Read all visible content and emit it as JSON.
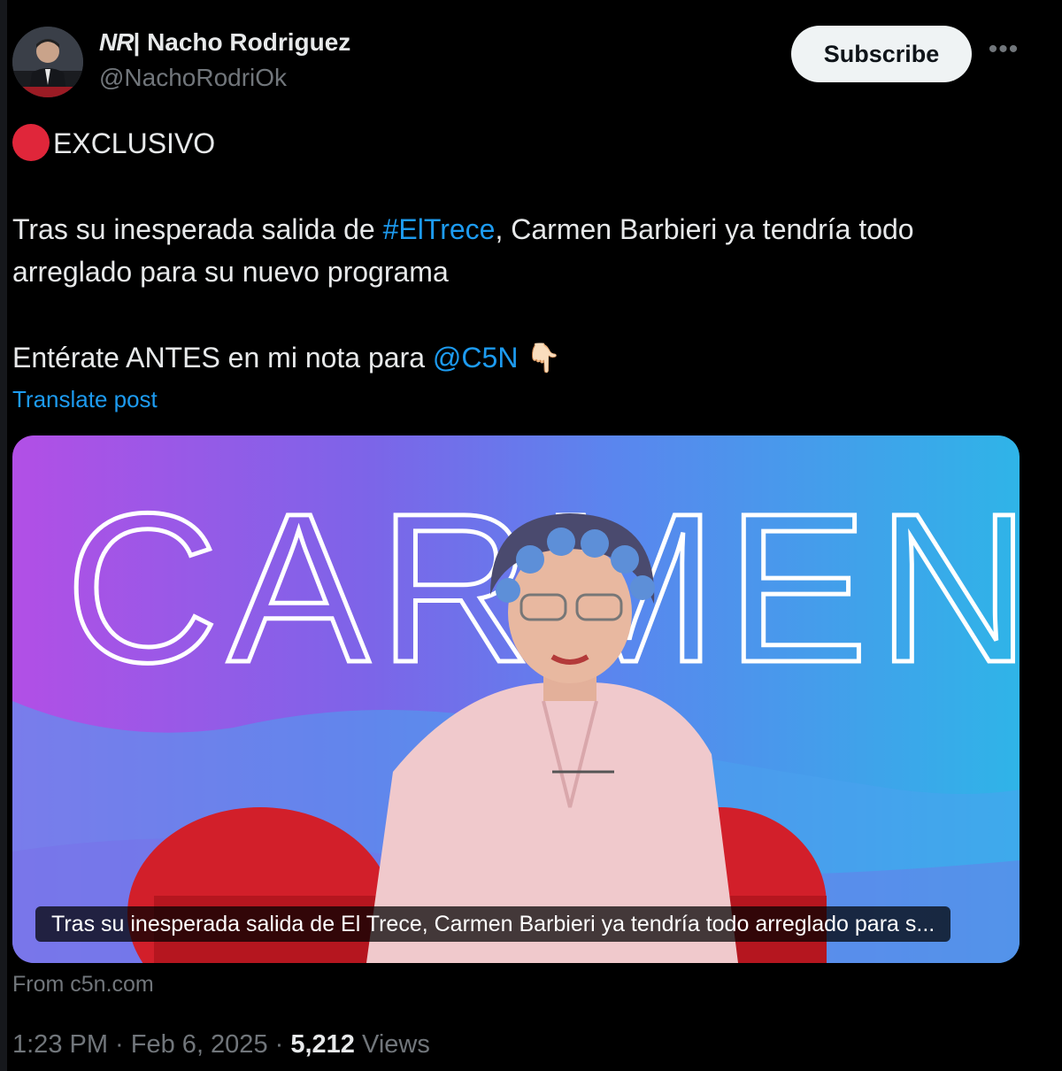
{
  "header": {
    "avatar_icon": "profile-photo",
    "logo_text": "NR",
    "display_name": " | Nacho Rodriguez",
    "handle": "@NachoRodriOk",
    "subscribe_label": "Subscribe",
    "more_label": "•••"
  },
  "tweet": {
    "line1": "EXCLUSIVO",
    "line2_a": "Tras su inesperada salida de ",
    "line2_hashtag": "#ElTrece",
    "line2_b": ", Carmen Barbieri ya tendría todo",
    "line3": "arreglado para su nuevo programa",
    "line4_a": "Entérate ANTES en mi nota para ",
    "line4_mention": "@C5N",
    "line4_emoji": "👇🏻",
    "translate_label": "Translate post"
  },
  "card": {
    "image_title": "CARMEN",
    "caption": "Tras su inesperada salida de El Trece, Carmen Barbieri ya tendría todo arreglado para s...",
    "from_label": "From c5n.com"
  },
  "meta": {
    "time": "1:23 PM",
    "sep1": " · ",
    "date": "Feb 6, 2025",
    "sep2": " · ",
    "views_count": "5,212",
    "views_label": " Views"
  },
  "colors": {
    "background": "#000000",
    "link": "#1d9bf0",
    "muted": "#71767b"
  }
}
